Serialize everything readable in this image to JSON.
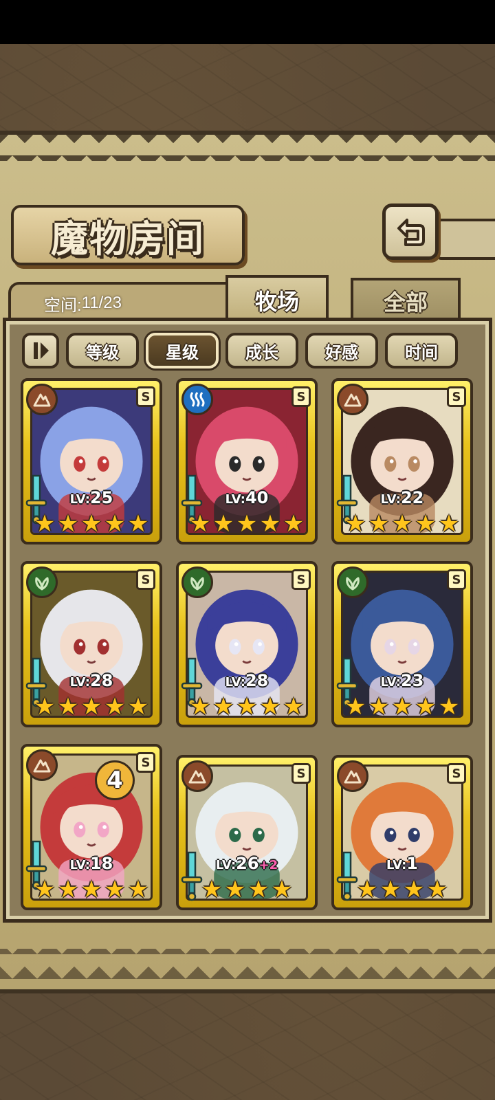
{
  "title": "魔物房间",
  "space": {
    "label": "空间:",
    "value": "11/23"
  },
  "tabs": [
    {
      "label": "牧场",
      "active": true
    },
    {
      "label": "全部",
      "active": false
    }
  ],
  "sort": {
    "options": [
      "等级",
      "星级",
      "成长",
      "好感",
      "时间"
    ],
    "selected": "星级"
  },
  "monsters": [
    {
      "attribute": "earth",
      "level": "25",
      "level_bonus": "",
      "stars": 5,
      "rank": "S",
      "badge": "",
      "palette": [
        "#3c3a7a",
        "#8aa2e6",
        "#c43b3b"
      ]
    },
    {
      "attribute": "water",
      "level": "40",
      "level_bonus": "",
      "stars": 5,
      "rank": "S",
      "badge": "",
      "palette": [
        "#8a2432",
        "#d94a6a",
        "#2b2b2b"
      ]
    },
    {
      "attribute": "earth",
      "level": "22",
      "level_bonus": "",
      "stars": 5,
      "rank": "S",
      "badge": "",
      "palette": [
        "#e7dcc0",
        "#3a2620",
        "#b98a62"
      ]
    },
    {
      "attribute": "wood",
      "level": "28",
      "level_bonus": "",
      "stars": 5,
      "rank": "S",
      "badge": "",
      "palette": [
        "#6a5a2a",
        "#e6e6ea",
        "#a23030"
      ]
    },
    {
      "attribute": "wood",
      "level": "28",
      "level_bonus": "",
      "stars": 5,
      "rank": "S",
      "badge": "",
      "palette": [
        "#c9b7a6",
        "#3b3f9a",
        "#e6e6f5"
      ]
    },
    {
      "attribute": "wood",
      "level": "23",
      "level_bonus": "",
      "stars": 5,
      "rank": "S",
      "badge": "",
      "palette": [
        "#2a2a3a",
        "#3b5a9a",
        "#e6d6e6"
      ]
    },
    {
      "attribute": "earth",
      "level": "18",
      "level_bonus": "",
      "stars": 5,
      "rank": "S",
      "badge": "4",
      "palette": [
        "#c6b68a",
        "#c43b3b",
        "#f2a6c6"
      ]
    },
    {
      "attribute": "earth",
      "level": "26",
      "level_bonus": "+2",
      "stars": 4,
      "rank": "S",
      "badge": "",
      "palette": [
        "#c5c0a2",
        "#e8eef0",
        "#2c6a4a"
      ]
    },
    {
      "attribute": "earth",
      "level": "1",
      "level_bonus": "",
      "stars": 4,
      "rank": "S",
      "badge": "",
      "palette": [
        "#d9cba6",
        "#e07a3a",
        "#2f3c6a"
      ]
    }
  ],
  "level_prefix": "LV:"
}
